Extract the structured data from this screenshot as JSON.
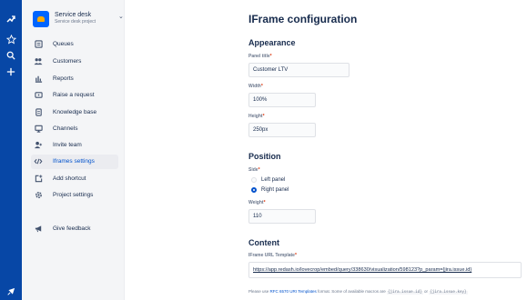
{
  "global_nav": {
    "icons": [
      "app-logo-icon",
      "star-icon",
      "search-icon",
      "plus-icon",
      "feedback-icon"
    ]
  },
  "sidebar": {
    "project_name": "Service desk",
    "project_type": "Service desk project",
    "items": [
      {
        "label": "Queues",
        "icon": "queues-icon"
      },
      {
        "label": "Customers",
        "icon": "customers-icon"
      },
      {
        "label": "Reports",
        "icon": "reports-icon"
      },
      {
        "label": "Raise a request",
        "icon": "raise-request-icon"
      },
      {
        "label": "Knowledge base",
        "icon": "knowledge-base-icon"
      },
      {
        "label": "Channels",
        "icon": "channels-icon"
      },
      {
        "label": "Invite team",
        "icon": "invite-team-icon"
      },
      {
        "label": "Iframes settings",
        "icon": "code-icon",
        "active": true
      },
      {
        "label": "Add shortcut",
        "icon": "add-shortcut-icon"
      },
      {
        "label": "Project settings",
        "icon": "gear-icon"
      },
      {
        "label": "Give feedback",
        "icon": "megaphone-icon"
      }
    ]
  },
  "main": {
    "title": "IFrame configuration",
    "appearance": {
      "heading": "Appearance",
      "panel_title_label": "Panel title",
      "panel_title_value": "Customer LTV",
      "width_label": "Width",
      "width_value": "100%",
      "height_label": "Height",
      "height_value": "250px"
    },
    "position": {
      "heading": "Position",
      "side_label": "Side",
      "left_panel": "Left panel",
      "right_panel": "Right panel",
      "selected": "Right panel",
      "weight_label": "Weight",
      "weight_value": "110"
    },
    "content": {
      "heading": "Content",
      "url_label": "IFrame URL Template",
      "url_value": "https://app.redash.io/lovecrop/embed/query/338630/visualization/598123?p_param={jira.issue.id}",
      "help_prefix": "Please use",
      "help_link": "RFC 6570 URI Templates",
      "help_middle": "format. Some of available macros are",
      "macro1": "{jira.issue.id}",
      "help_or": "or",
      "macro2": "{jira.issue.key}"
    },
    "required_mark": "*"
  }
}
